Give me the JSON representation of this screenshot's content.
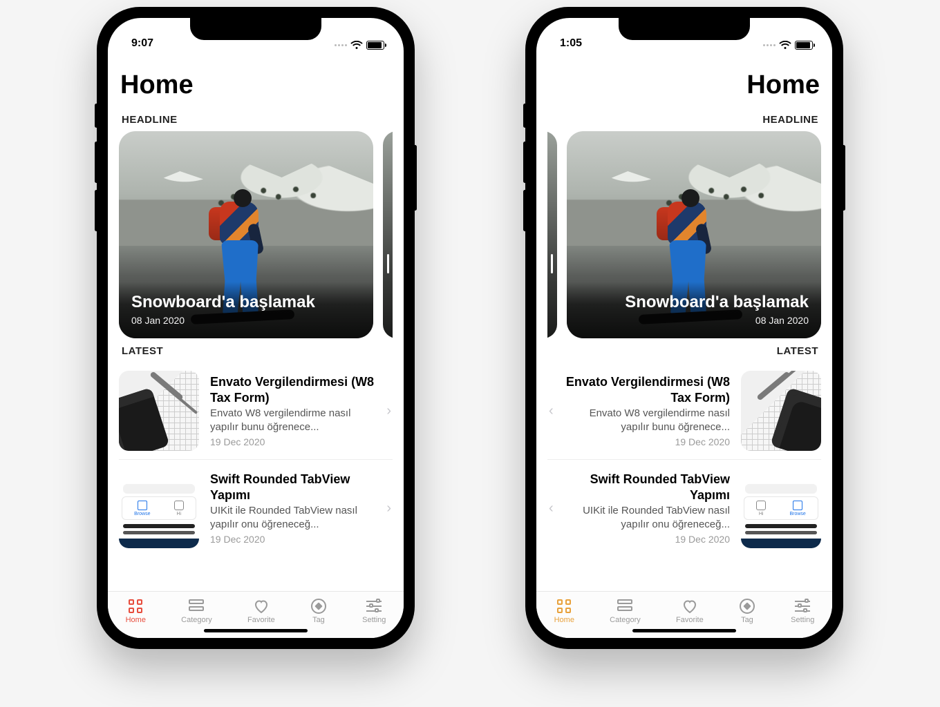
{
  "phones": [
    {
      "id": "ltr",
      "status_time": "9:07",
      "accent": "red",
      "page_title": "Home",
      "sections": {
        "headline": "HEADLINE",
        "latest": "LATEST"
      },
      "headline": {
        "title": "Snowboard'a başlamak",
        "date": "08 Jan 2020"
      },
      "latest": [
        {
          "title": "Envato Vergilendirmesi (W8 Tax Form)",
          "desc": "Envato W8 vergilendirme nasıl yapılır bunu öğrenece...",
          "date": "19 Dec 2020",
          "thumb": "tax"
        },
        {
          "title": "Swift Rounded TabView Yapımı",
          "desc": "UIKit ile Rounded TabView nasıl yapılır onu öğreneceğ...",
          "date": "19 Dec 2020",
          "thumb": "swift"
        }
      ],
      "tabs": [
        {
          "key": "home",
          "label": "Home",
          "icon": "grid",
          "active": true
        },
        {
          "key": "category",
          "label": "Category",
          "icon": "rows"
        },
        {
          "key": "favorite",
          "label": "Favorite",
          "icon": "heart"
        },
        {
          "key": "tag",
          "label": "Tag",
          "icon": "tag"
        },
        {
          "key": "setting",
          "label": "Setting",
          "icon": "sliders"
        }
      ]
    },
    {
      "id": "rtl",
      "status_time": "1:05",
      "accent": "orange",
      "page_title": "Home",
      "sections": {
        "headline": "HEADLINE",
        "latest": "LATEST"
      },
      "headline": {
        "title": "Snowboard'a başlamak",
        "date": "08 Jan 2020"
      },
      "latest": [
        {
          "title": "Envato Vergilendirmesi (W8 Tax Form)",
          "desc": "Envato W8 vergilendirme nasıl yapılır bunu öğrenece...",
          "date": "19 Dec 2020",
          "thumb": "tax"
        },
        {
          "title": "Swift Rounded TabView Yapımı",
          "desc": "UIKit ile Rounded TabView nasıl yapılır onu öğreneceğ...",
          "date": "19 Dec 2020",
          "thumb": "swift"
        }
      ],
      "tabs": [
        {
          "key": "home",
          "label": "Home",
          "icon": "grid",
          "active": true
        },
        {
          "key": "category",
          "label": "Category",
          "icon": "rows"
        },
        {
          "key": "favorite",
          "label": "Favorite",
          "icon": "heart"
        },
        {
          "key": "tag",
          "label": "Tag",
          "icon": "tag"
        },
        {
          "key": "setting",
          "label": "Setting",
          "icon": "sliders"
        }
      ]
    }
  ],
  "thumb_labels": {
    "browse": "Browse",
    "hi": "Hi"
  }
}
